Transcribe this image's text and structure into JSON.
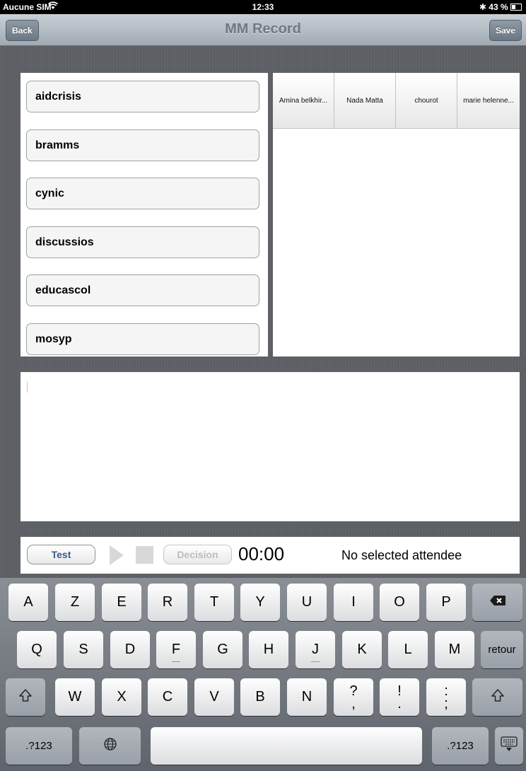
{
  "status_bar": {
    "carrier": "Aucune SIM",
    "wifi_icon": "wifi-icon",
    "time": "12:33",
    "bluetooth_icon": "bluetooth-icon",
    "battery": "43 %"
  },
  "navbar": {
    "back_label": "Back",
    "title": "MM Record",
    "save_label": "Save"
  },
  "topics": [
    {
      "label": "aidcrisis"
    },
    {
      "label": "bramms"
    },
    {
      "label": "cynic"
    },
    {
      "label": "discussios"
    },
    {
      "label": "educascol"
    },
    {
      "label": "mosyp"
    }
  ],
  "attendees": [
    {
      "name": "Amina belkhir..."
    },
    {
      "name": "Nada Matta"
    },
    {
      "name": "chourot"
    },
    {
      "name": "marie helenne..."
    }
  ],
  "notes": {
    "value": ""
  },
  "controls": {
    "test_label": "Test",
    "decision_label": "Decision",
    "timer": "00:00",
    "attendee_status": "No selected attendee"
  },
  "keyboard": {
    "row1": [
      "A",
      "Z",
      "E",
      "R",
      "T",
      "Y",
      "U",
      "I",
      "O",
      "P"
    ],
    "row2": [
      "Q",
      "S",
      "D",
      "F",
      "G",
      "H",
      "J",
      "K",
      "L",
      "M"
    ],
    "return_label": "retour",
    "row3": [
      "W",
      "X",
      "C",
      "V",
      "B",
      "N"
    ],
    "punct": [
      [
        "?",
        ","
      ],
      [
        "!",
        "."
      ],
      [
        ":",
        ";"
      ]
    ],
    "numbers_label": ".?123",
    "accent_color": "#3b5a8a",
    "icons": [
      "delete-icon",
      "shift-icon",
      "globe-icon",
      "keyboard-hide-icon"
    ]
  }
}
